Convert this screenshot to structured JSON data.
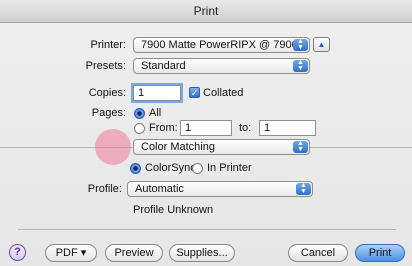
{
  "window": {
    "title": "Print"
  },
  "printer": {
    "label": "Printer:",
    "value": "7900 Matte PowerRIPX @ 7900..."
  },
  "presets": {
    "label": "Presets:",
    "value": "Standard"
  },
  "copies": {
    "label": "Copies:",
    "value": "1",
    "collated_label": "Collated",
    "collated_checked": true
  },
  "pages": {
    "label": "Pages:",
    "all_label": "All",
    "from_label": "From:",
    "from_value": "1",
    "to_label": "to:",
    "to_value": "1",
    "selected": "All"
  },
  "section": {
    "value": "Color Matching"
  },
  "matching": {
    "colorsync_label": "ColorSync",
    "inprinter_label": "In Printer",
    "selected": "ColorSync"
  },
  "profile": {
    "label": "Profile:",
    "value": "Automatic",
    "status": "Profile Unknown"
  },
  "footer": {
    "help_label": "?",
    "pdf_label": "PDF ▾",
    "preview_label": "Preview",
    "supplies_label": "Supplies...",
    "cancel_label": "Cancel",
    "print_label": "Print"
  },
  "colors": {
    "accent": "#4d92e4",
    "cursor_highlight": "#ef7896"
  }
}
